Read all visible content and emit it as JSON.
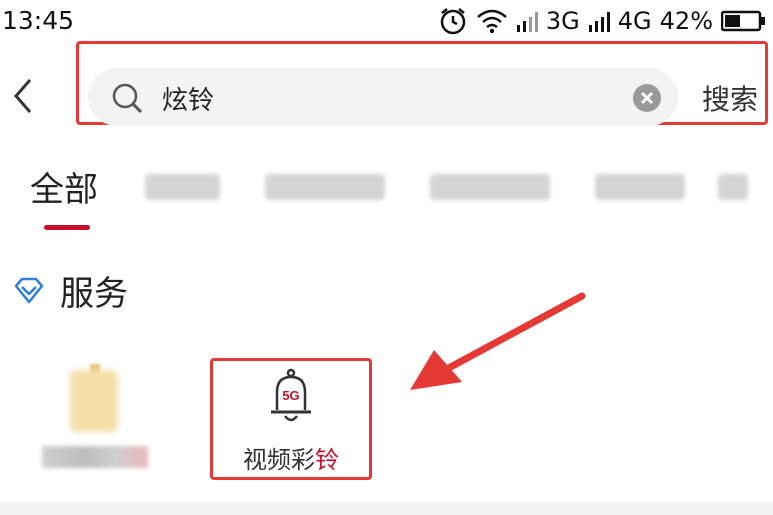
{
  "status_bar": {
    "time": "13:45",
    "network_3g": "3G",
    "network_4g": "4G",
    "battery": "42%"
  },
  "search": {
    "query": "炫铃",
    "button_label": "搜索"
  },
  "tabs": {
    "active_label": "全部"
  },
  "section": {
    "title": "服务"
  },
  "services": {
    "featured_label_main": "视频彩",
    "featured_label_accent": "铃",
    "bell_badge": "5G"
  },
  "colors": {
    "accent_red": "#c8102e",
    "highlight_red": "#e53935",
    "diamond_blue": "#2f7fd8"
  }
}
